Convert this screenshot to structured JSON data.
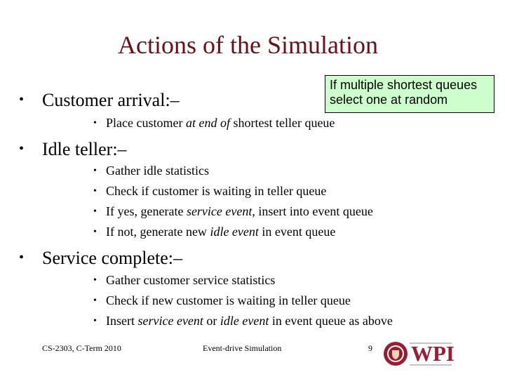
{
  "slide": {
    "title": "Actions of the Simulation",
    "callout": {
      "line1": "If multiple shortest queues",
      "line2": "select one at random",
      "background_color": "#ccffcc"
    },
    "bullet_glyph": "•",
    "sections": [
      {
        "heading": "Customer arrival:–",
        "items": [
          {
            "parts": [
              {
                "t": "Place customer ",
                "i": false
              },
              {
                "t": "at end of",
                "i": true
              },
              {
                "t": " shortest teller queue",
                "i": false
              }
            ]
          }
        ]
      },
      {
        "heading": "Idle teller:–",
        "items": [
          {
            "parts": [
              {
                "t": "Gather idle statistics",
                "i": false
              }
            ]
          },
          {
            "parts": [
              {
                "t": "Check if customer is waiting in teller queue",
                "i": false
              }
            ]
          },
          {
            "parts": [
              {
                "t": "If yes, generate ",
                "i": false
              },
              {
                "t": "service event",
                "i": true
              },
              {
                "t": ", insert into event queue",
                "i": false
              }
            ]
          },
          {
            "parts": [
              {
                "t": "If not, generate new ",
                "i": false
              },
              {
                "t": "idle event",
                "i": true
              },
              {
                "t": " in event queue",
                "i": false
              }
            ]
          }
        ]
      },
      {
        "heading": "Service complete:–",
        "items": [
          {
            "parts": [
              {
                "t": "Gather customer service statistics",
                "i": false
              }
            ]
          },
          {
            "parts": [
              {
                "t": "Check if new customer is waiting in teller queue",
                "i": false
              }
            ]
          },
          {
            "parts": [
              {
                "t": "Insert ",
                "i": false
              },
              {
                "t": "service event",
                "i": true
              },
              {
                "t": " or ",
                "i": false
              },
              {
                "t": "idle event",
                "i": true
              },
              {
                "t": " in event queue as above",
                "i": false
              }
            ]
          }
        ]
      }
    ],
    "footer": {
      "course": "CS-2303, C-Term 2010",
      "topic": "Event-drive Simulation",
      "page_number": "9",
      "logo_text": "WPI"
    },
    "colors": {
      "title": "#6b0f14",
      "logo_red": "#9b1b30"
    }
  }
}
